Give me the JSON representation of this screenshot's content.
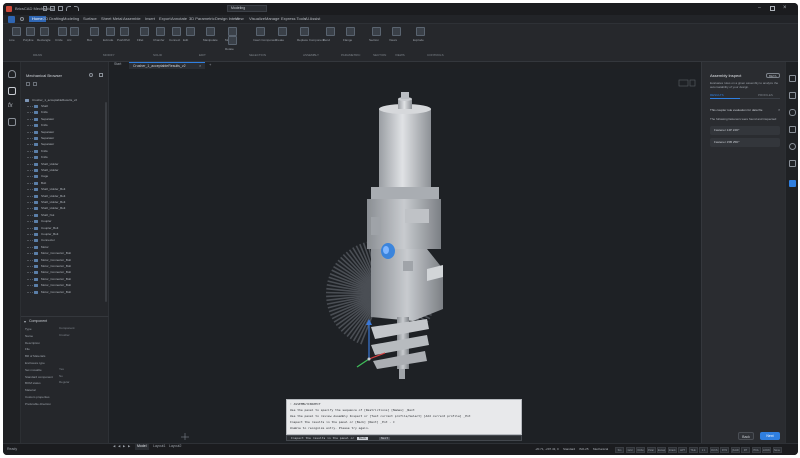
{
  "window": {
    "title": "BricsCAD Mechanical"
  },
  "menu": {
    "items": [
      "Home",
      "2D Drafting",
      "Modeling",
      "Surface",
      "Sheet Metal",
      "Assemble",
      "Insert",
      "Export",
      "Annotate",
      "3D Parametric",
      "Design Intent",
      "View",
      "Visualize",
      "Manage",
      "Express Tools",
      "AI Assist"
    ],
    "active_index": 0,
    "workspace": "Modeling"
  },
  "ribbon": {
    "buttons": [
      "Line",
      "Polyline",
      "Rectangle",
      "Circle",
      "Arc",
      "Box",
      "Extrude",
      "Push/Pull",
      "Fillet",
      "Chamfer",
      "Connect",
      "Edit",
      "Manipulate",
      "Move",
      "Rotate",
      "Insert Component",
      "Create",
      "Replace Component",
      "Bend",
      "Flange",
      "Section",
      "Views",
      "Explode"
    ],
    "groups": [
      "DRAW",
      "MODIFY",
      "SOLID",
      "EDIT",
      "SELECTION",
      "ASSEMBLY",
      "PARAMETRIC",
      "SECTION",
      "VIEWS",
      "CONTROLS"
    ]
  },
  "browser": {
    "title": "Mechanical Browser",
    "root": "Crusher_1_acceptableResults_v2",
    "items": [
      "Shaft",
      "Knife",
      "Separator",
      "Knife",
      "Separator",
      "Separator",
      "Separator",
      "Knife",
      "Knife",
      "Shaft_Holder",
      "Shaft_Holder",
      "Cage",
      "Bolt",
      "Shaft_Holder_Bolt",
      "Shaft_Holder_Bolt",
      "Shaft_Holder_Bolt",
      "Shaft_Holder_Bolt",
      "Shaft_Nut",
      "Coupler",
      "Coupler_Bolt",
      "Coupler_Bolt",
      "Connector",
      "Motor",
      "Motor_Connector_Bolt",
      "Motor_Connector_Bolt",
      "Motor_Connector_Bolt",
      "Motor_Connector_Bolt",
      "Motor_Connector_Bolt",
      "Motor_Connector_Bolt",
      "Motor_Connector_Bolt"
    ]
  },
  "properties": {
    "header": "Component",
    "rows": [
      {
        "label": "Type",
        "value": "Component"
      },
      {
        "label": "Name",
        "value": "Crusher"
      },
      {
        "label": "Description",
        "value": ""
      },
      {
        "label": "File",
        "value": ""
      },
      {
        "label": "Bill of Materials",
        "value": ""
      },
      {
        "label": "Enclosure type",
        "value": ""
      },
      {
        "label": "Set movable",
        "value": "Yes"
      },
      {
        "label": "Standard component",
        "value": "No"
      },
      {
        "label": "BOM status",
        "value": "Regular"
      },
      {
        "label": "Material",
        "value": ""
      },
      {
        "label": "Custom properties",
        "value": ""
      },
      {
        "label": "Preferable direction",
        "value": ""
      }
    ]
  },
  "doctabs": {
    "start": "Start",
    "active": "Crusher_1_acceptableResults_v2"
  },
  "command": {
    "lines": [
      ": ASSEMBLYINSPECT",
      "Use the panel to specify the sequence of [Restrictions] [Names] _Next",
      "Use the panel to review Assembly Inspect or [Test current profile/Select] [Add current profile] _Ent",
      "Inspect the results in the panel or [Back] [Next] _Ent - C",
      "Unable to recognize entry. Please try again."
    ],
    "prompt": "Inspect the results in the panel or",
    "opt1": "Back",
    "opt2": "Next"
  },
  "inspect": {
    "title": "Assembly Inspect",
    "badge": "BETA",
    "description": "Evaluates rules on a given assembly to analyze the automatability of your design.",
    "tabs": [
      "RESULTS",
      "PROFILES"
    ],
    "section": "This coupler rule evaluation for data file",
    "found": "The following fasteners were found and inspected:",
    "results": [
      "Fastener 14P 22D°",
      "Fastener 15B 25D°"
    ],
    "back": "Back",
    "next": "Next"
  },
  "layout_tabs": {
    "items": [
      "Model",
      "Layout1",
      "Layout2"
    ],
    "active": "Model"
  },
  "status": {
    "left": "Ready",
    "coords": "-20.71, -297.43, 0",
    "standard": "Standard",
    "iso": "ISO-25",
    "workspace": "Mechanical",
    "cells": [
      "Sm",
      "Grid",
      "Ortho",
      "Polar",
      "Esnap",
      "Strack",
      "LWT",
      "TILE",
      "1:1",
      "DUCS",
      "DYN",
      "QUAD",
      "RT",
      "HKA",
      "LOCKUI",
      "None"
    ]
  },
  "colors": {
    "accent": "#2f7fe0",
    "bg": "#1d1f22",
    "panel": "#25272b",
    "blade": "#4a4e54"
  }
}
